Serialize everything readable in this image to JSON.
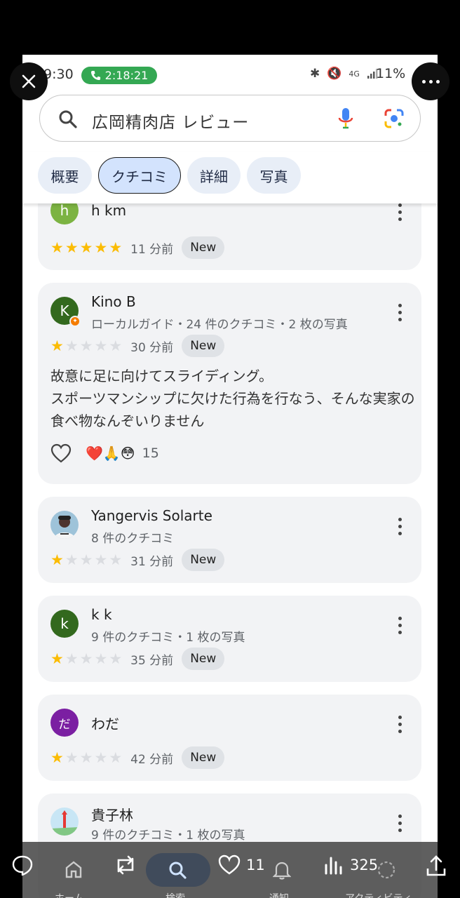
{
  "status_bar": {
    "time": "9:30",
    "call_duration": "2:18:21",
    "battery": "11%"
  },
  "search": {
    "query": "広岡精肉店 レビュー"
  },
  "tabs": [
    {
      "label": "概要"
    },
    {
      "label": "クチコミ"
    },
    {
      "label": "詳細"
    },
    {
      "label": "写真"
    }
  ],
  "reviews": [
    {
      "name": "h km",
      "initial": "h",
      "avatar_color": "#7cb342",
      "meta": "",
      "rating": 5,
      "time": "11 分前",
      "badge": "New"
    },
    {
      "name": "Kino B",
      "initial": "K",
      "avatar_color": "#33691e",
      "meta": "ローカルガイド・24 件のクチコミ・2 枚の写真",
      "rating": 1,
      "time": "30 分前",
      "badge": "New",
      "text": "故意に足に向けてスライディング。\nスポーツマンシップに欠けた行為を行なう、そんな実家の食べ物なんぞいりません",
      "reactions": "❤️🙏😳",
      "reaction_count": "15"
    },
    {
      "name": "Yangervis Solarte",
      "initial": "",
      "avatar_color": "#cfd8dc",
      "meta": "8 件のクチコミ",
      "rating": 1,
      "time": "31 分前",
      "badge": "New"
    },
    {
      "name": "k k",
      "initial": "k",
      "avatar_color": "#33691e",
      "meta": "9 件のクチコミ・1 枚の写真",
      "rating": 1,
      "time": "35 分前",
      "badge": "New"
    },
    {
      "name": "わだ",
      "initial": "だ",
      "avatar_color": "#7b1fa2",
      "meta": "",
      "rating": 1,
      "time": "42 分前",
      "badge": "New"
    },
    {
      "name": "貴子林",
      "initial": "",
      "avatar_color": "#b3e5fc",
      "meta": "9 件のクチコミ・1 枚の写真",
      "rating": 1,
      "time": "",
      "badge": ""
    }
  ],
  "x_actions": {
    "likes": "11",
    "views": "325"
  },
  "x_nav": [
    "ホーム",
    "検索",
    "通知",
    "アクティビティ"
  ]
}
